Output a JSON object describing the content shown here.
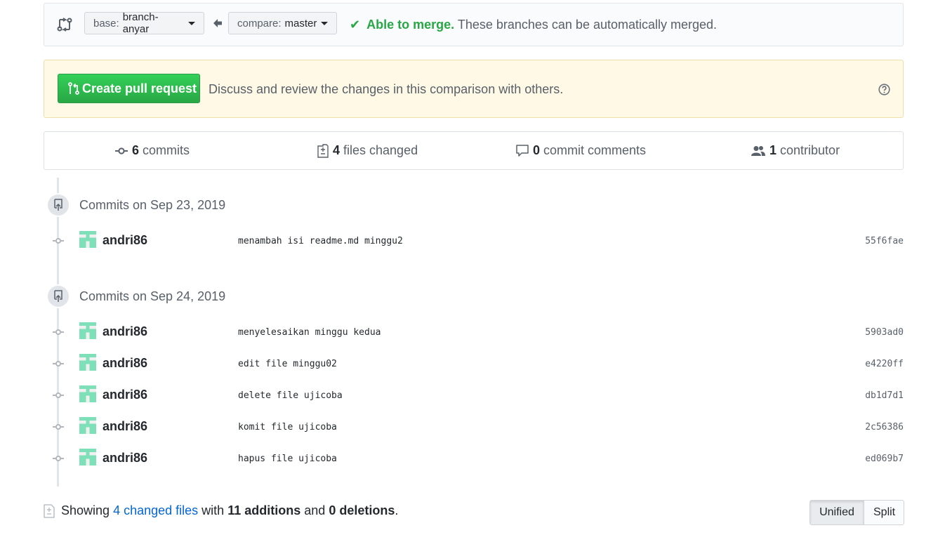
{
  "range": {
    "base_prefix": "base:",
    "base_branch": "branch-anyar",
    "compare_prefix": "compare:",
    "compare_branch": "master",
    "merge_status_strong": "Able to merge.",
    "merge_status_text": "These branches can be automatically merged.",
    "merge_check": "✔"
  },
  "pull_request": {
    "button_label": "Create pull request",
    "description": "Discuss and review the changes in this comparison with others."
  },
  "summary": {
    "commits_count": "6",
    "commits_label": "commits",
    "files_count": "4",
    "files_label": "files changed",
    "comments_count": "0",
    "comments_label": "commit comments",
    "contributors_count": "1",
    "contributors_label": "contributor"
  },
  "commit_groups": [
    {
      "title": "Commits on Sep 23, 2019",
      "commits": [
        {
          "author": "andri86",
          "message": "menambah isi readme.md minggu2",
          "sha": "55f6fae"
        }
      ]
    },
    {
      "title": "Commits on Sep 24, 2019",
      "commits": [
        {
          "author": "andri86",
          "message": "menyelesaikan minggu kedua",
          "sha": "5903ad0"
        },
        {
          "author": "andri86",
          "message": "edit file minggu02",
          "sha": "e4220ff"
        },
        {
          "author": "andri86",
          "message": "delete file ujicoba",
          "sha": "db1d7d1"
        },
        {
          "author": "andri86",
          "message": "komit file ujicoba",
          "sha": "2c56386"
        },
        {
          "author": "andri86",
          "message": "hapus file ujicoba",
          "sha": "ed069b7"
        }
      ]
    }
  ],
  "files_summary": {
    "showing": "Showing",
    "changed_files_link": "4 changed files",
    "with": "with",
    "additions": "11 additions",
    "and": "and",
    "deletions": "0 deletions",
    "period": "."
  },
  "view_toggle": {
    "unified": "Unified",
    "split": "Split",
    "active": "Unified"
  },
  "colors": {
    "merge_ok": "#28a745",
    "link": "#0366d6",
    "pr_button": "#2ea44f",
    "pr_box_bg": "#fff9e6",
    "avatar": "#7ee0b8"
  },
  "icons": {
    "range": "git-compare-icon",
    "arrow": "arrow-left-icon",
    "check": "check-icon",
    "pr": "git-pull-request-icon",
    "help": "question-icon",
    "commits": "git-commit-icon",
    "files": "file-diff-icon",
    "comments": "comment-icon",
    "contributors": "people-icon",
    "day": "repo-push-icon"
  }
}
